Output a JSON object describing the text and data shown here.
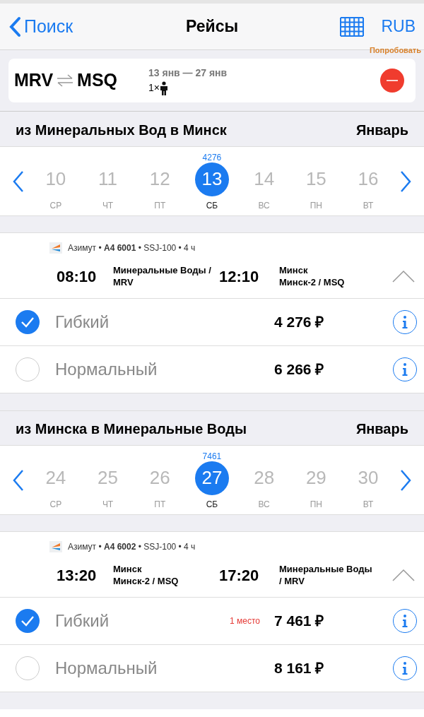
{
  "header": {
    "back_label": "Поиск",
    "title": "Рейсы",
    "currency": "RUB",
    "promo": "Попробовать"
  },
  "search": {
    "from": "MRV",
    "to": "MSQ",
    "dates": "13 янв — 27 янв",
    "passengers": "1×"
  },
  "legs": [
    {
      "title": "из Минеральных Вод в Минск",
      "month": "Январь",
      "price_label": "4276",
      "dates": [
        {
          "day": "10",
          "weekday": "СР",
          "selected": false
        },
        {
          "day": "11",
          "weekday": "ЧТ",
          "selected": false
        },
        {
          "day": "12",
          "weekday": "ПТ",
          "selected": false
        },
        {
          "day": "13",
          "weekday": "СБ",
          "selected": true
        },
        {
          "day": "14",
          "weekday": "ВС",
          "selected": false
        },
        {
          "day": "15",
          "weekday": "ПН",
          "selected": false
        },
        {
          "day": "16",
          "weekday": "ВТ",
          "selected": false
        }
      ],
      "flight": {
        "meta": "Азимут • **A4 6001** • SSJ-100 • 4 ч",
        "dep_time": "08:10",
        "dep_place": "Минеральные Воды /\nMRV",
        "arr_time": "12:10",
        "arr_place": "Минск\nМинск-2 / MSQ",
        "expanded": true
      },
      "fares": [
        {
          "name": "Гибкий",
          "price": "4 276 ₽",
          "selected": true
        },
        {
          "name": "Нормальный",
          "price": "6 266 ₽",
          "selected": false
        }
      ]
    },
    {
      "title": "из Минска в Минеральные Воды",
      "month": "Январь",
      "price_label": "7461",
      "dates": [
        {
          "day": "24",
          "weekday": "СР",
          "selected": false
        },
        {
          "day": "25",
          "weekday": "ЧТ",
          "selected": false
        },
        {
          "day": "26",
          "weekday": "ПТ",
          "selected": false
        },
        {
          "day": "27",
          "weekday": "СБ",
          "selected": true
        },
        {
          "day": "28",
          "weekday": "ВС",
          "selected": false
        },
        {
          "day": "29",
          "weekday": "ПН",
          "selected": false
        },
        {
          "day": "30",
          "weekday": "ВТ",
          "selected": false
        }
      ],
      "flight": {
        "meta": "Азимут • **A4 6002** • SSJ-100 • 4 ч",
        "dep_time": "13:20",
        "dep_place": "Минск\nМинск-2 / MSQ",
        "arr_time": "17:20",
        "arr_place": "Минеральные Воды\n/ MRV",
        "expanded": true
      },
      "fares": [
        {
          "name": "Гибкий",
          "price": "7 461 ₽",
          "selected": true,
          "note": "1 место"
        },
        {
          "name": "Нормальный",
          "price": "8 161 ₽",
          "selected": false
        }
      ]
    }
  ]
}
